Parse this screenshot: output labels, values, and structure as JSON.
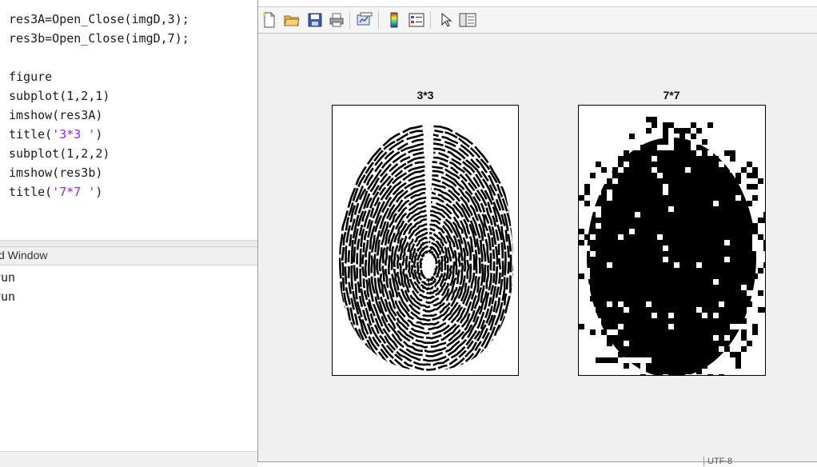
{
  "editor": {
    "lines": [
      {
        "code": "res3A=Open_Close(imgD,3);"
      },
      {
        "code": "res3b=Open_Close(imgD,7);"
      },
      {
        "code": ""
      },
      {
        "code": "figure"
      },
      {
        "code": "subplot(1,2,1)"
      },
      {
        "code": "imshow(res3A)"
      },
      {
        "pre": "title(",
        "str": "'3*3 '",
        "post": ")"
      },
      {
        "code": "subplot(1,2,2)"
      },
      {
        "code": "imshow(res3b)"
      },
      {
        "pre": "title(",
        "str": "'7*7 '",
        "post": ")"
      }
    ]
  },
  "command_window": {
    "title": "d Window",
    "lines": [
      "run",
      "run"
    ]
  },
  "figure": {
    "toolbar": [
      {
        "name": "new-figure-icon"
      },
      {
        "name": "open-file-icon"
      },
      {
        "name": "save-icon"
      },
      {
        "name": "print-icon"
      },
      {
        "name": "link-plot-icon"
      },
      {
        "name": "colorbar-icon"
      },
      {
        "name": "legend-icon"
      },
      {
        "name": "edit-plot-icon"
      },
      {
        "name": "property-inspector-icon"
      }
    ],
    "subplots": [
      {
        "title": "3*3",
        "image": "fingerprint-opened-closed-3x3"
      },
      {
        "title": "7*7",
        "image": "fingerprint-opened-closed-7x7"
      }
    ]
  },
  "statusbar": {
    "fragment": "UTF-8"
  },
  "colors": {
    "string_literal": "#a020f0",
    "figure_bg": "#f0f0f0"
  }
}
